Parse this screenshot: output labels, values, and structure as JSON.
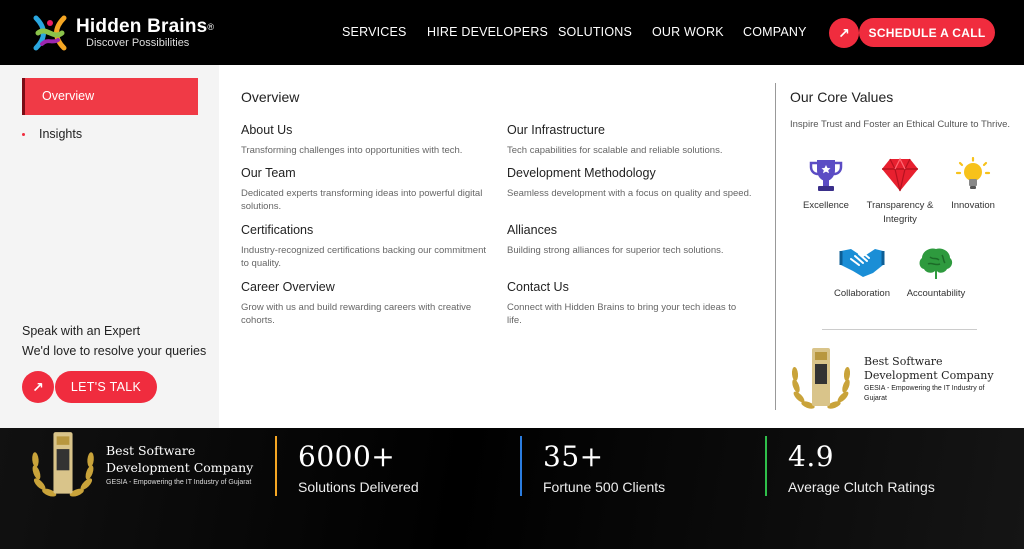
{
  "nav": {
    "logo_name": "Hidden Brains",
    "logo_reg": "®",
    "logo_tagline": "Discover Possibilities",
    "menu": [
      "SERVICES",
      "HIRE DEVELOPERS",
      "SOLUTIONS",
      "OUR WORK",
      "COMPANY"
    ],
    "cta_label": "SCHEDULE A CALL",
    "arrow_glyph": "↗",
    "accent": "#f02c3e"
  },
  "sidebar": {
    "active_item": "Overview",
    "items": [
      "Insights"
    ],
    "expert_heading": "Speak with an Expert",
    "expert_text": "We'd love to resolve your queries",
    "talk_label": "LET'S TALK"
  },
  "overview": {
    "title": "Overview",
    "links": [
      {
        "title": "About Us",
        "desc": "Transforming challenges into opportunities with tech."
      },
      {
        "title": "Our Infrastructure",
        "desc": "Tech capabilities for scalable and reliable solutions."
      },
      {
        "title": "Our Team",
        "desc": "Dedicated experts transforming ideas into powerful digital solutions."
      },
      {
        "title": "Development Methodology",
        "desc": "Seamless development with a focus on quality and speed."
      },
      {
        "title": "Certifications",
        "desc": "Industry-recognized certifications backing our commitment to quality."
      },
      {
        "title": "Alliances",
        "desc": "Building strong alliances for superior tech solutions."
      },
      {
        "title": "Career Overview",
        "desc": "Grow with us and build rewarding careers with creative cohorts."
      },
      {
        "title": "Contact Us",
        "desc": "Connect with Hidden Brains to bring your tech ideas to life."
      }
    ]
  },
  "core_values": {
    "title": "Our Core Values",
    "subtitle": "Inspire Trust and Foster an Ethical Culture to Thrive.",
    "values": [
      {
        "label": "Excellence",
        "icon": "trophy-icon"
      },
      {
        "label": "Transparency & Integrity",
        "icon": "diamond-icon"
      },
      {
        "label": "Innovation",
        "icon": "lightbulb-icon"
      },
      {
        "label": "Collaboration",
        "icon": "handshake-icon"
      },
      {
        "label": "Accountability",
        "icon": "brain-tree-icon"
      }
    ]
  },
  "award": {
    "title_line1": "Best Software",
    "title_line2": "Development Company",
    "subtitle": "GESIA - Empowering the IT Industry of Gujarat"
  },
  "stats": [
    {
      "value": "6000+",
      "label": "Solutions Delivered",
      "color": "#f5a623"
    },
    {
      "value": "35+",
      "label": "Fortune 500 Clients",
      "color": "#2b7de0"
    },
    {
      "value": "4.9",
      "label": "Average Clutch Ratings",
      "color": "#2fbf4a"
    }
  ]
}
